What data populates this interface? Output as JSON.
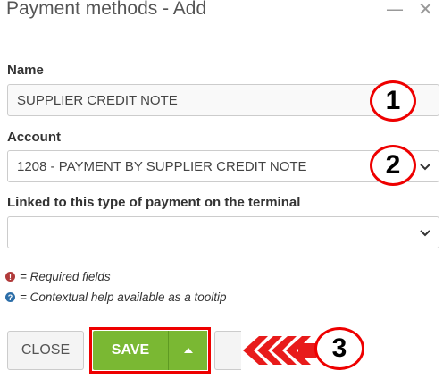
{
  "window": {
    "title": "Payment methods - Add",
    "minimize_glyph": "—",
    "close_glyph": "✕"
  },
  "form": {
    "name_label": "Name",
    "name_value": "SUPPLIER CREDIT NOTE",
    "account_label": "Account",
    "account_value": "1208 - PAYMENT BY SUPPLIER CREDIT NOTE",
    "linked_label": "Linked to this type of payment on the terminal",
    "linked_value": ""
  },
  "notes": {
    "required": "= Required fields",
    "help": "= Contextual help available as a tooltip"
  },
  "buttons": {
    "close": "CLOSE",
    "save": "SAVE"
  },
  "annotations": {
    "one": "1",
    "two": "2",
    "three": "3"
  },
  "colors": {
    "save_green": "#7ab833",
    "highlight_red": "#ee0000",
    "required_icon": "#b03a3a",
    "help_icon": "#2c6ea8"
  },
  "icons": [
    "minimize-icon",
    "close-icon",
    "chevron-down-icon",
    "required-icon",
    "help-icon",
    "caret-up-icon",
    "arrow-left-icon"
  ]
}
